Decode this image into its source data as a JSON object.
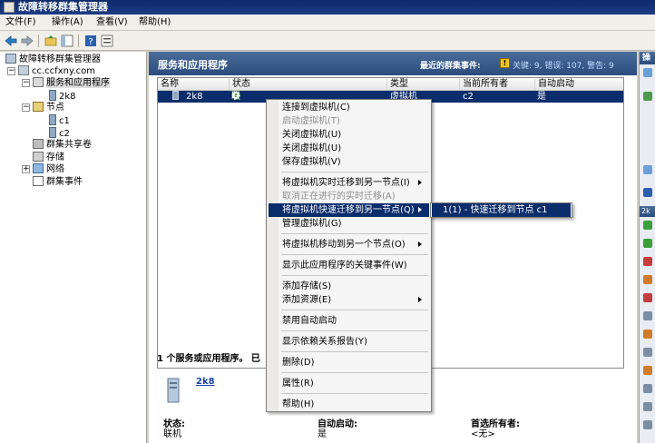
{
  "window": {
    "title": "故障转移群集管理器"
  },
  "menu": [
    "文件(F)",
    "操作(A)",
    "查看(V)",
    "帮助(H)"
  ],
  "tree": {
    "root": "故障转移群集管理器",
    "cluster": "cc.ccfxny.com",
    "services": "服务和应用程序",
    "vm": "2k8",
    "nodes": "节点",
    "node1": "c1",
    "node2": "c2",
    "csv": "群集共享卷",
    "storage": "存储",
    "network": "网络",
    "events": "群集事件"
  },
  "center": {
    "title": "服务和应用程序",
    "recent_events_label": "最近的群集事件:",
    "events_links": "关键: 9, 错误: 107, 警告: 9",
    "columns": [
      "名称",
      "状态",
      "类型",
      "当前所有者",
      "自动启动"
    ],
    "row": {
      "name": "2k8",
      "status": "联机",
      "type": "虚拟机",
      "owner": "c2",
      "autostart": "是"
    },
    "summary": "1 个服务或应用程序。 已",
    "detail_name": "2k8",
    "details": {
      "status_label": "状态:",
      "status_value": "联机",
      "autostart_label": "自动启动:",
      "autostart_value": "是",
      "preferred_label": "首选所有者:",
      "preferred_value": "<无>"
    }
  },
  "actions": {
    "header": "操",
    "section": "2k"
  },
  "context_menu": {
    "items": [
      {
        "label": "连接到虚拟机(C)"
      },
      {
        "label": "启动虚拟机(T)",
        "disabled": true
      },
      {
        "label": "关闭虚拟机(U)"
      },
      {
        "label": "关闭虚拟机(U)"
      },
      {
        "label": "保存虚拟机(V)"
      },
      {
        "label": "将虚拟机实时迁移到另一节点(I)"
      },
      {
        "label": "取消正在进行的实时迁移(A)",
        "disabled": true
      },
      {
        "label": "将虚拟机快速迁移到另一节点(Q)"
      },
      {
        "label": "管理虚拟机(G)"
      },
      {
        "label": "将虚拟机移动到另一个节点(O)"
      },
      {
        "label": "显示此应用程序的关键事件(W)"
      },
      {
        "label": "添加存储(S)"
      },
      {
        "label": "添加资源(E)"
      },
      {
        "label": "禁用自动启动"
      },
      {
        "label": "显示依赖关系报告(Y)"
      },
      {
        "label": "删除(D)"
      },
      {
        "label": "属性(R)"
      },
      {
        "label": "帮助(H)"
      }
    ]
  },
  "submenu": {
    "label": "1(1) - 快速迁移到节点 c1"
  }
}
